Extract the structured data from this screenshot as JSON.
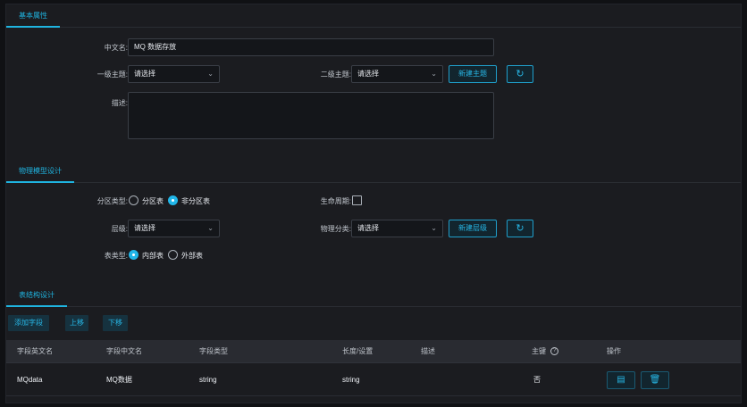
{
  "basic": {
    "tab": "基本属性",
    "cn_name_label": "中文名:",
    "cn_name_value": "MQ 数据存放",
    "level1_label": "一级主题:",
    "level1_value": "请选择",
    "level2_label": "二级主题:",
    "level2_value": "请选择",
    "new_subject": "新建主题",
    "desc_label": "描述:",
    "desc_value": ""
  },
  "physical": {
    "tab": "物理模型设计",
    "partition_label": "分区类型:",
    "partition_options": [
      "分区表",
      "非分区表"
    ],
    "partition_selected": "非分区表",
    "lifecycle_label": "生命周期:",
    "layer_label": "层级:",
    "layer_value": "请选择",
    "phys_class_label": "物理分类:",
    "phys_class_value": "请选择",
    "new_layer": "新建层级",
    "table_type_label": "表类型:",
    "table_type_options": [
      "内部表",
      "外部表"
    ],
    "table_type_selected": "内部表"
  },
  "structure": {
    "tab": "表结构设计",
    "add_field": "添加字段",
    "move_up": "上移",
    "move_down": "下移",
    "columns": [
      "字段英文名",
      "字段中文名",
      "字段类型",
      "长度/设置",
      "描述",
      "主键",
      "操作"
    ],
    "rows": [
      {
        "en": "MQdata",
        "cn": "MQ数据",
        "type": "string",
        "length": "string",
        "desc": "",
        "pk": "否"
      }
    ]
  },
  "icons": {
    "refresh": "refresh-icon",
    "chevron": "chevron-down-icon",
    "help": "help-circle-icon",
    "edit": "edit-icon",
    "delete": "delete-icon"
  },
  "colors": {
    "accent": "#1fb4e0",
    "background": "#101114",
    "panel": "#1b1c20"
  }
}
